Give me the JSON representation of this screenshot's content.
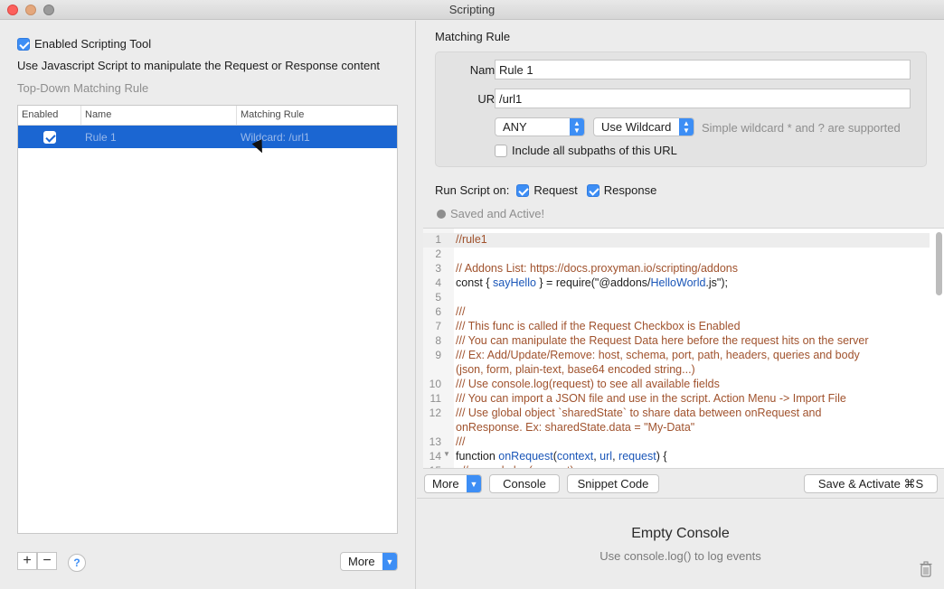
{
  "window": {
    "title": "Scripting"
  },
  "left": {
    "enabled_label": "Enabled Scripting Tool",
    "description": "Use Javascript Script to manipulate the Request or Response content",
    "section_title": "Top-Down Matching Rule",
    "table": {
      "columns": [
        "Enabled",
        "Name",
        "Matching Rule"
      ],
      "rows": [
        {
          "enabled": true,
          "name": "Rule 1",
          "matching_rule": "Wildcard: /url1"
        }
      ]
    },
    "add_glyph": "+",
    "remove_glyph": "−",
    "help_glyph": "?",
    "more_label": "More"
  },
  "right": {
    "matching_rule_title": "Matching Rule",
    "name_label": "Name:",
    "name_value": "Rule 1",
    "url_label": "URL:",
    "url_value": "/url1",
    "method_select": "ANY",
    "match_type_select": "Use Wildcard",
    "wildcard_hint": "Simple wildcard * and ? are supported",
    "include_subpaths_label": "Include all subpaths of this URL",
    "run_script_label": "Run Script on:",
    "request_label": "Request",
    "response_label": "Response",
    "status_text": "Saved and Active!",
    "code_lines": [
      {
        "n": "1",
        "text": "//rule1",
        "kind": "comment"
      },
      {
        "n": "2",
        "text": "",
        "kind": "plain"
      },
      {
        "n": "3",
        "text": "// Addons List: https://docs.proxyman.io/scripting/addons",
        "kind": "comment"
      },
      {
        "n": "4",
        "text": "const { sayHello } = require(\"@addons/HelloWorld.js\");",
        "kind": "plain"
      },
      {
        "n": "5",
        "text": "",
        "kind": "plain"
      },
      {
        "n": "6",
        "text": "///",
        "kind": "comment"
      },
      {
        "n": "7",
        "text": "/// This func is called if the Request Checkbox is Enabled",
        "kind": "comment"
      },
      {
        "n": "8",
        "text": "/// You can manipulate the Request Data here before the request hits on the server",
        "kind": "comment"
      },
      {
        "n": "9",
        "text": "/// Ex: Add/Update/Remove: host, schema, port, path, headers, queries and body",
        "kind": "comment"
      },
      {
        "n": "",
        "text": "(json, form, plain-text, base64 encoded string...)",
        "kind": "comment"
      },
      {
        "n": "10",
        "text": "/// Use console.log(request) to see all available fields",
        "kind": "comment"
      },
      {
        "n": "11",
        "text": "/// You can import a JSON file and use in the script. Action Menu -> Import File",
        "kind": "comment"
      },
      {
        "n": "12",
        "text": "/// Use global object `sharedState` to share data between onRequest and",
        "kind": "comment"
      },
      {
        "n": "",
        "text": "onResponse. Ex: sharedState.data = \"My-Data\"",
        "kind": "comment"
      },
      {
        "n": "13",
        "text": "///",
        "kind": "comment"
      },
      {
        "n": "14",
        "text": "function onRequest(context, url, request) {",
        "kind": "plain"
      },
      {
        "n": "15",
        "text": "  // console.log(request);",
        "kind": "comment"
      }
    ],
    "more_label": "More",
    "console_button": "Console",
    "snippet_button": "Snippet Code",
    "save_button": "Save & Activate ⌘S",
    "console_title": "Empty Console",
    "console_subtitle": "Use console.log() to log events"
  },
  "colors": {
    "accent": "#3d8ef5",
    "selection": "#1b66d2",
    "comment": "#a0522d",
    "identifier": "#1a56b8"
  }
}
